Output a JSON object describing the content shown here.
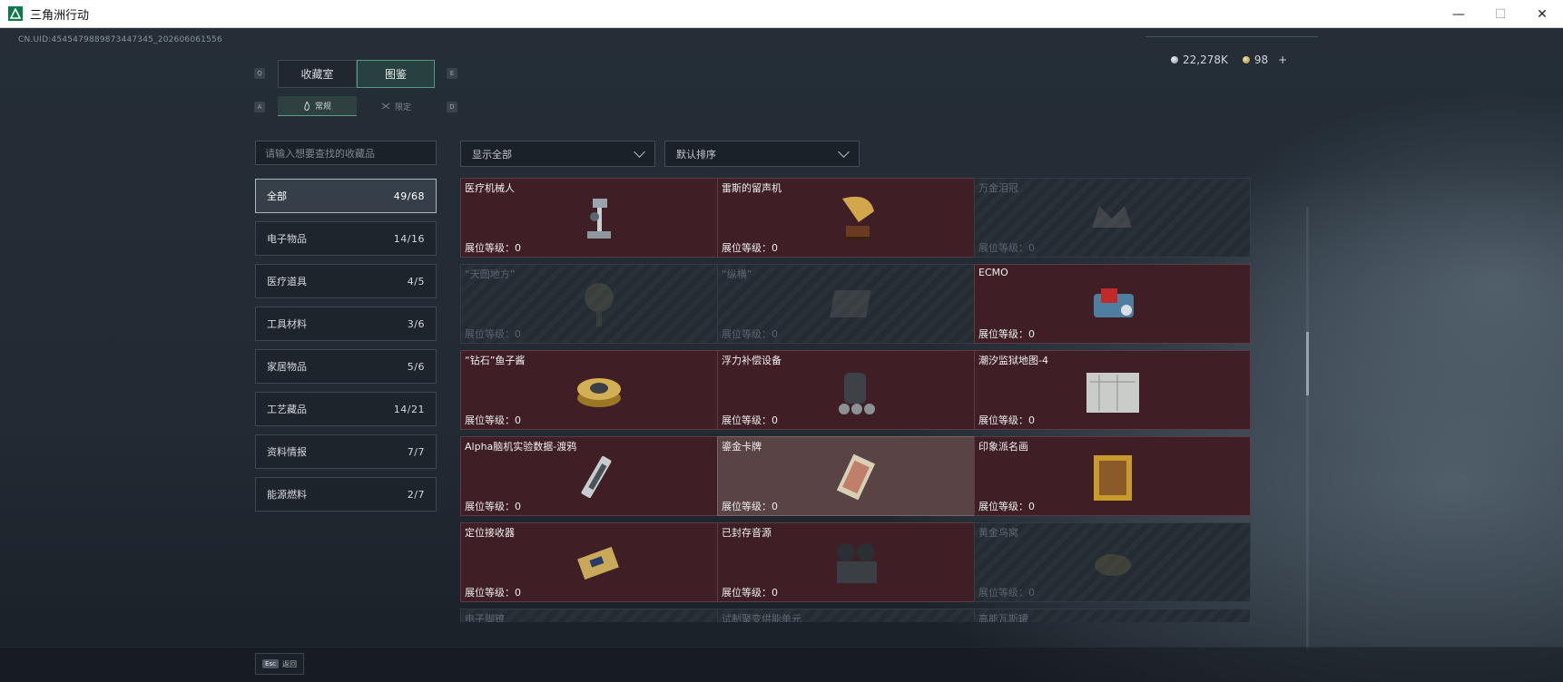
{
  "window": {
    "title": "三角洲行动",
    "minimize": "—",
    "maximize": "☐",
    "close": "✕"
  },
  "header": {
    "uid": "CN.UID:4545479889873447345_202606061556",
    "currency_silver": "22,278K",
    "currency_gold": "98",
    "add_label": "+"
  },
  "tabs": {
    "key_left": "Q",
    "key_right": "E",
    "items": [
      {
        "label": "收藏室"
      },
      {
        "label": "图鉴"
      }
    ],
    "sub_key_left": "A",
    "sub_key_right": "D",
    "sub_items": [
      {
        "label": "常规"
      },
      {
        "label": "限定"
      }
    ]
  },
  "search": {
    "placeholder": "请输入想要查找的收藏品"
  },
  "filters": {
    "show": "显示全部",
    "sort": "默认排序"
  },
  "categories": [
    {
      "label": "全部",
      "count": "49/68"
    },
    {
      "label": "电子物品",
      "count": "14/16"
    },
    {
      "label": "医疗道具",
      "count": "4/5"
    },
    {
      "label": "工具材料",
      "count": "3/6"
    },
    {
      "label": "家居物品",
      "count": "5/6"
    },
    {
      "label": "工艺藏品",
      "count": "14/21"
    },
    {
      "label": "资料情报",
      "count": "7/7"
    },
    {
      "label": "能源燃料",
      "count": "2/7"
    }
  ],
  "level_prefix": "展位等级：",
  "items": [
    {
      "name": "医疗机械人",
      "level": "0",
      "locked": false,
      "icon": "medical-robot-icon"
    },
    {
      "name": "雷斯的留声机",
      "level": "0",
      "locked": false,
      "icon": "gramophone-icon"
    },
    {
      "name": "万金泪冠",
      "level": "0",
      "locked": true,
      "icon": "crown-icon"
    },
    {
      "name": "“天圆地方”",
      "level": "0",
      "locked": true,
      "icon": "tree-icon"
    },
    {
      "name": "“纵横”",
      "level": "0",
      "locked": true,
      "icon": "chessboard-icon"
    },
    {
      "name": "ECMO",
      "level": "0",
      "locked": false,
      "icon": "ecmo-icon"
    },
    {
      "name": "“钻石”鱼子酱",
      "level": "0",
      "locked": false,
      "icon": "caviar-tin-icon"
    },
    {
      "name": "浮力补偿设备",
      "level": "0",
      "locked": false,
      "icon": "buoyancy-device-icon"
    },
    {
      "name": "潮汐监狱地图-4",
      "level": "0",
      "locked": false,
      "icon": "map-icon"
    },
    {
      "name": "Alpha脑机实验数据-渡鸦",
      "level": "0",
      "locked": false,
      "icon": "data-device-icon"
    },
    {
      "name": "鎏金卡牌",
      "level": "0",
      "locked": false,
      "icon": "gilded-card-icon"
    },
    {
      "name": "印象派名画",
      "level": "0",
      "locked": false,
      "icon": "painting-icon"
    },
    {
      "name": "定位接收器",
      "level": "0",
      "locked": false,
      "icon": "receiver-icon"
    },
    {
      "name": "已封存音源",
      "level": "0",
      "locked": false,
      "icon": "tape-recorder-icon"
    },
    {
      "name": "黄金鸟窝",
      "level": "0",
      "locked": true,
      "icon": "nest-icon"
    },
    {
      "name": "电子脚镣",
      "level": "",
      "locked": true,
      "icon": "anklet-icon"
    },
    {
      "name": "试制聚变供能单元",
      "level": "",
      "locked": true,
      "icon": "fusion-unit-icon"
    },
    {
      "name": "高能瓦斯罐",
      "level": "",
      "locked": true,
      "icon": "gas-tank-icon"
    }
  ],
  "footer": {
    "esc_key": "Esc",
    "back_label": "返回"
  },
  "colors": {
    "accent": "#4f9c80",
    "card_owned": "#3f1f25",
    "card_locked": "#242b32"
  }
}
